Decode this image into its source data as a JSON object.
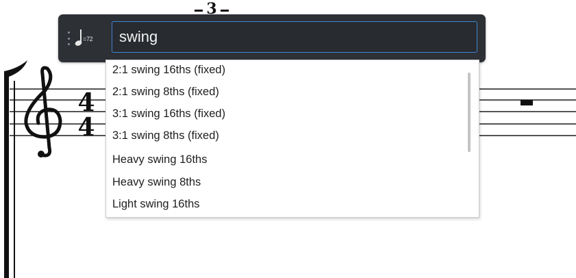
{
  "score": {
    "tuplet_number": "3",
    "time_signature_numerator": "4",
    "time_signature_denominator": "4",
    "clef": "treble-clef-icon"
  },
  "popover": {
    "drag_handle_icon": "drag-handle-icon",
    "tempo_marking": "=72",
    "search_value": "swing"
  },
  "autocomplete": {
    "options": [
      "2:1 swing 16ths (fixed)",
      "2:1 swing 8ths (fixed)",
      "3:1 swing 16ths (fixed)",
      "3:1 swing 8ths (fixed)",
      "Heavy swing 16ths",
      "Heavy swing 8ths",
      "Light swing 16ths"
    ]
  },
  "colors": {
    "popover_background": "#2d3035",
    "input_border_accent": "#3d86d6"
  }
}
